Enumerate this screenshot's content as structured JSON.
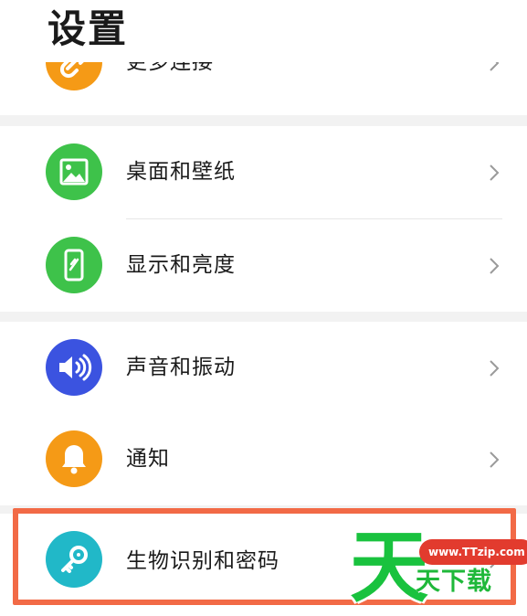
{
  "header": {
    "title": "设置"
  },
  "colors": {
    "more_connections": "#f59a16",
    "wallpaper": "#3ec24a",
    "display": "#3ec24a",
    "sound": "#3b53e0",
    "notifications": "#f59a16",
    "biometrics": "#21b8c8",
    "highlight_border": "#f26a46",
    "watermark_green": "#19c23e",
    "watermark_red": "#e23b2e"
  },
  "items": [
    {
      "label": "更多连接",
      "icon": "link-icon"
    },
    {
      "label": "桌面和壁纸",
      "icon": "image-icon"
    },
    {
      "label": "显示和亮度",
      "icon": "phone-display-icon"
    },
    {
      "label": "声音和振动",
      "icon": "speaker-icon"
    },
    {
      "label": "通知",
      "icon": "bell-icon"
    },
    {
      "label": "生物识别和密码",
      "icon": "key-icon"
    }
  ],
  "watermark": {
    "big_char": "天",
    "url": "www.TTzip.com",
    "small_text": "天下载"
  }
}
